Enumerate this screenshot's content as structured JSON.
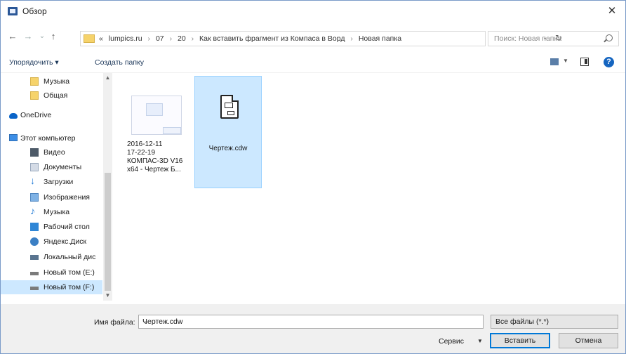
{
  "window": {
    "title": "Обзор"
  },
  "nav": {
    "back": "←",
    "forward": "→",
    "recent": "⌄",
    "up": "↑"
  },
  "address": {
    "crumbs": [
      "«",
      "lumpics.ru",
      "07",
      "20",
      "Как вставить фрагмент из Компаса в Ворд",
      "Новая папка"
    ],
    "separator": "›"
  },
  "search": {
    "placeholder": "Поиск: Новая папка"
  },
  "toolbar": {
    "organize": "Упорядочить ▾",
    "new_folder": "Создать папку"
  },
  "sidebar": {
    "items": [
      {
        "label": "Музыка",
        "icon": "folder",
        "indent": 1
      },
      {
        "label": "Общая",
        "icon": "folder",
        "indent": 1
      },
      {
        "label": "OneDrive",
        "icon": "cloud",
        "indent": 0
      },
      {
        "label": "Этот компьютер",
        "icon": "pc",
        "indent": 0
      },
      {
        "label": "Видео",
        "icon": "video",
        "indent": 1
      },
      {
        "label": "Документы",
        "icon": "docs",
        "indent": 1
      },
      {
        "label": "Загрузки",
        "icon": "down",
        "indent": 1
      },
      {
        "label": "Изображения",
        "icon": "pics",
        "indent": 1
      },
      {
        "label": "Музыка",
        "icon": "music",
        "indent": 1
      },
      {
        "label": "Рабочий стол",
        "icon": "desk",
        "indent": 1
      },
      {
        "label": "Яндекс.Диск",
        "icon": "yadisk",
        "indent": 1
      },
      {
        "label": "Локальный дис",
        "icon": "disk",
        "indent": 1
      },
      {
        "label": "Новый том (E:)",
        "icon": "drive",
        "indent": 1
      },
      {
        "label": "Новый том (F:)",
        "icon": "drive",
        "indent": 1,
        "selected": true
      }
    ]
  },
  "files": [
    {
      "name": "2016-12-11\n17-22-19\nКОМПАС-3D V16\nx64 - Чертеж Б...",
      "selected": false
    },
    {
      "name": "Чертеж.cdw",
      "selected": true
    }
  ],
  "bottom": {
    "filename_label": "Имя файла:",
    "filename_value": "Чертеж.cdw",
    "filter_value": "Все файлы (*.*)",
    "service_label": "Сервис",
    "insert_label": "Вставить",
    "cancel_label": "Отмена"
  }
}
